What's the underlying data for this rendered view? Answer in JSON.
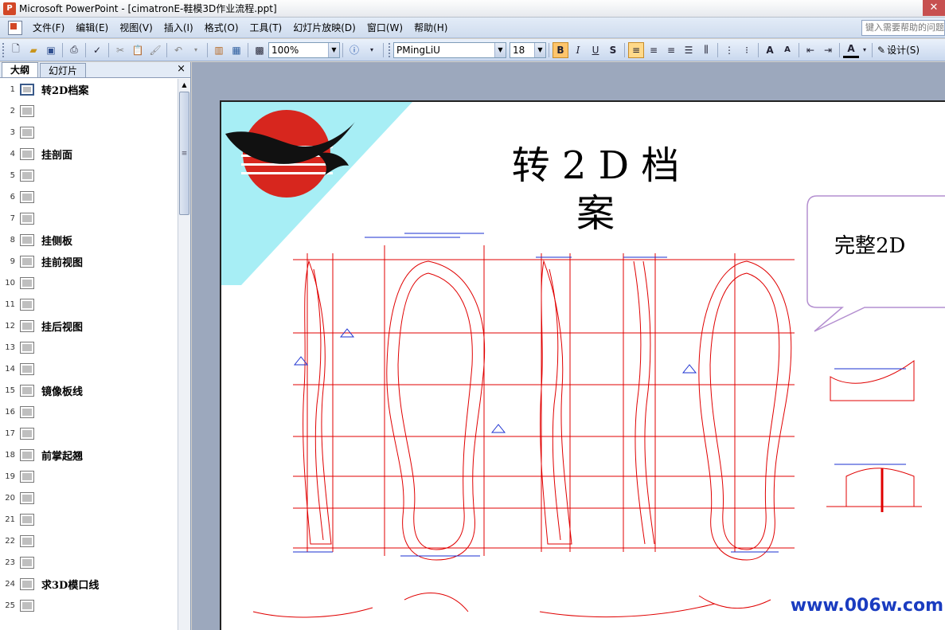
{
  "window": {
    "title": "Microsoft PowerPoint - [cimatronE-鞋模3D作业流程.ppt]"
  },
  "menu": {
    "items": [
      "文件(F)",
      "编辑(E)",
      "视图(V)",
      "插入(I)",
      "格式(O)",
      "工具(T)",
      "幻灯片放映(D)",
      "窗口(W)",
      "帮助(H)"
    ],
    "help_placeholder": "键入需要帮助的问题"
  },
  "toolbar": {
    "zoom": "100%",
    "font_name": "PMingLiU",
    "font_size": "18",
    "bold": "B",
    "italic": "I",
    "underline": "U",
    "shadow": "S",
    "design_label": "设计(S)"
  },
  "pane": {
    "tabs": [
      "大纲",
      "幻灯片"
    ],
    "close": "×",
    "outline": [
      {
        "n": "1",
        "title": "转2D档案",
        "selected": true
      },
      {
        "n": "2",
        "title": ""
      },
      {
        "n": "3",
        "title": ""
      },
      {
        "n": "4",
        "title": "挂剖面"
      },
      {
        "n": "5",
        "title": ""
      },
      {
        "n": "6",
        "title": ""
      },
      {
        "n": "7",
        "title": ""
      },
      {
        "n": "8",
        "title": "挂侧板"
      },
      {
        "n": "9",
        "title": "挂前视图"
      },
      {
        "n": "10",
        "title": ""
      },
      {
        "n": "11",
        "title": ""
      },
      {
        "n": "12",
        "title": "挂后视图"
      },
      {
        "n": "13",
        "title": ""
      },
      {
        "n": "14",
        "title": ""
      },
      {
        "n": "15",
        "title": "镜像板线"
      },
      {
        "n": "16",
        "title": ""
      },
      {
        "n": "17",
        "title": ""
      },
      {
        "n": "18",
        "title": "前掌起翘"
      },
      {
        "n": "19",
        "title": ""
      },
      {
        "n": "20",
        "title": ""
      },
      {
        "n": "21",
        "title": ""
      },
      {
        "n": "22",
        "title": ""
      },
      {
        "n": "23",
        "title": ""
      },
      {
        "n": "24",
        "title": "求3D模口线"
      },
      {
        "n": "25",
        "title": ""
      }
    ]
  },
  "slide": {
    "title": "转 2 D 档案",
    "callout": "完整2D",
    "watermark": "www.006w.com"
  }
}
